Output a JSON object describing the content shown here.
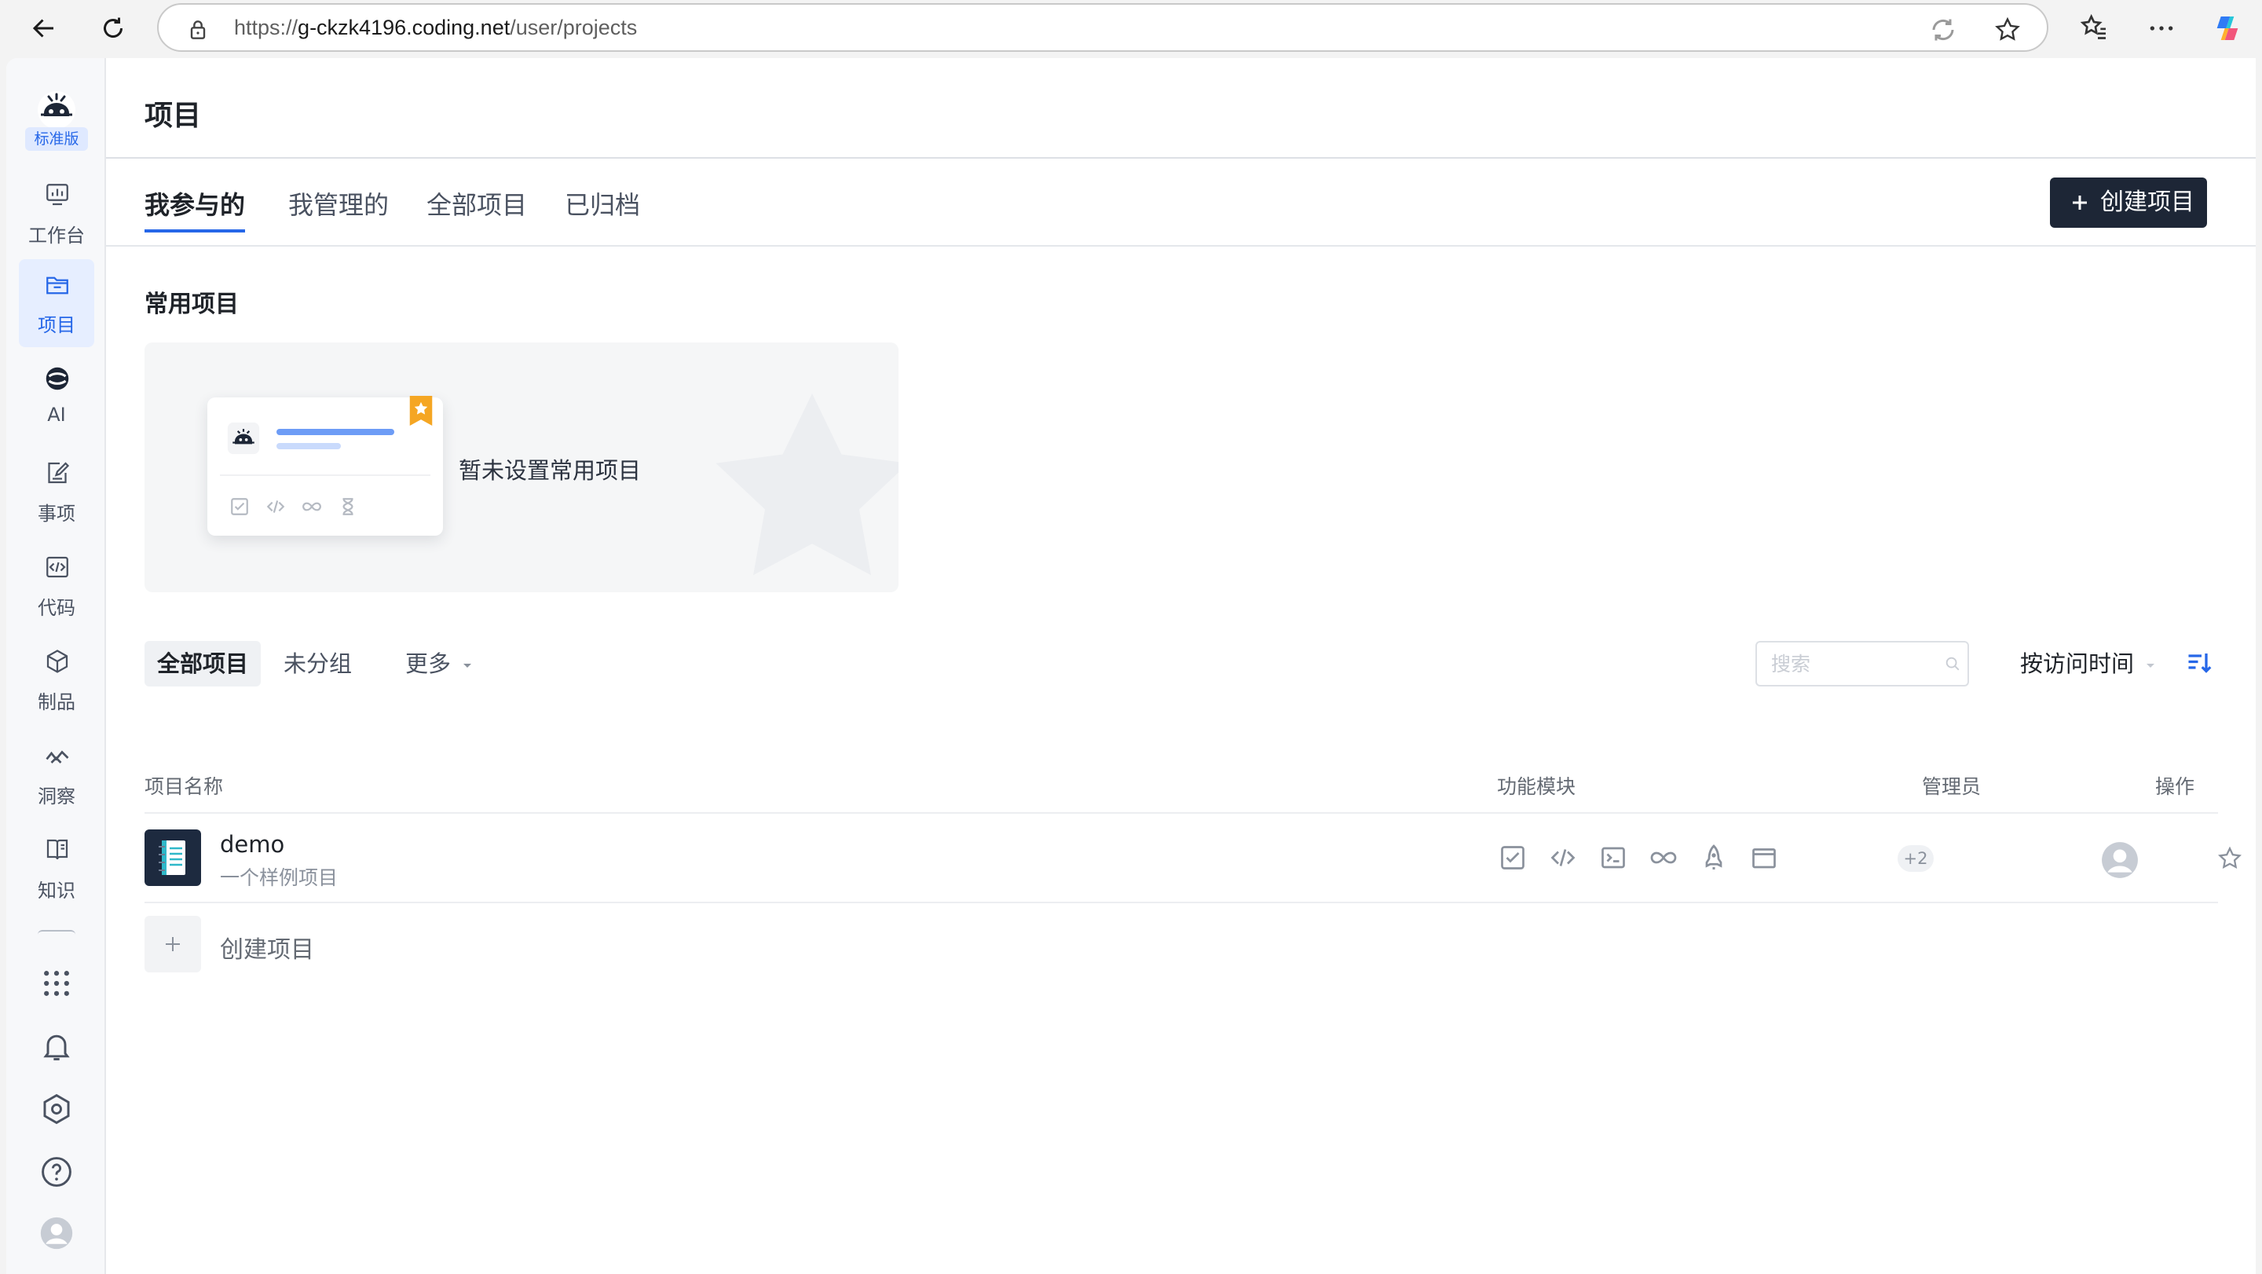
{
  "browser": {
    "url_scheme": "https://",
    "url_host": "g-ckzk4196.coding.net",
    "url_path": "/user/projects"
  },
  "rail": {
    "edition": "标准版",
    "items": [
      {
        "label": "工作台",
        "icon": "dashboard-icon"
      },
      {
        "label": "项目",
        "icon": "project-folder-icon",
        "active": true
      },
      {
        "label": "AI",
        "icon": "ai-logo-icon"
      },
      {
        "label": "事项",
        "icon": "issue-edit-icon"
      },
      {
        "label": "代码",
        "icon": "code-icon"
      },
      {
        "label": "制品",
        "icon": "artifact-box-icon"
      },
      {
        "label": "洞察",
        "icon": "insight-chart-icon"
      },
      {
        "label": "知识",
        "icon": "knowledge-book-icon"
      }
    ],
    "bottom_icons": [
      "apps-grid-icon",
      "bell-icon",
      "settings-hexagon-icon",
      "help-icon",
      "user-avatar-icon"
    ]
  },
  "page": {
    "title": "项目",
    "tabs": [
      "我参与的",
      "我管理的",
      "全部项目",
      "已归档"
    ],
    "active_tab": "我参与的",
    "create_button": "创建项目"
  },
  "favorites": {
    "title": "常用项目",
    "empty_text": "暂未设置常用项目"
  },
  "filter": {
    "tabs": [
      "全部项目",
      "未分组",
      "更多"
    ],
    "active": "全部项目",
    "search_placeholder": "搜索",
    "sort_label": "按访问时间"
  },
  "table": {
    "columns": [
      "项目名称",
      "功能模块",
      "管理员",
      "操作"
    ],
    "rows": [
      {
        "name": "demo",
        "description": "一个样例项目",
        "modules": [
          "issue-check-icon",
          "code-icon",
          "terminal-icon",
          "infinity-ci-icon",
          "rocket-icon",
          "artifact-window-icon"
        ],
        "more_modules": "+2"
      }
    ],
    "add_label": "创建项目"
  },
  "colors": {
    "accent": "#2667e8",
    "dark_button": "#1d2636",
    "rail_bg": "#f7f8fa"
  }
}
